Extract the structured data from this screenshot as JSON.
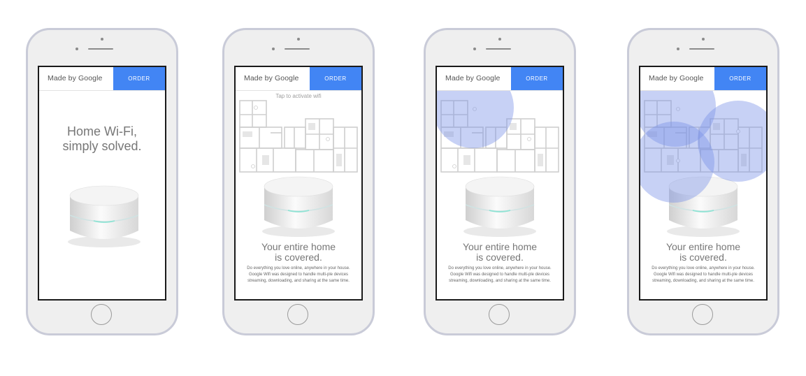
{
  "app": {
    "brand": "Made by Google",
    "order_label": "ORDER"
  },
  "screen1": {
    "title_line1": "Home Wi-Fi,",
    "title_line2": "simply solved."
  },
  "screens": {
    "tap_prompt": "Tap to activate wifi",
    "cover_title_line1": "Your entire home",
    "cover_title_line2": "is covered.",
    "cover_body": "Do everything you love online, anywhere in your house. Google Wifi was designed to handle multi-ple devices streaming, downloading, and sharing at the same time."
  },
  "colors": {
    "accent": "#4285f4",
    "coverage": "#7992e6",
    "frame": "#c9cbd8"
  },
  "icons": {
    "router": "router-icon",
    "floorplan": "floorplan-icon"
  }
}
